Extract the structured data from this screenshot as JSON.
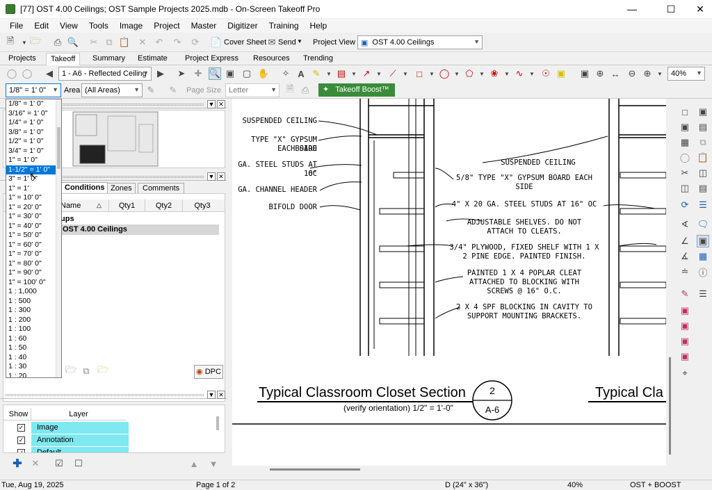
{
  "window": {
    "title": "[77] OST 4.00 Ceilings; OST Sample Projects 2025.mdb - On-Screen Takeoff Pro"
  },
  "menu": [
    "File",
    "Edit",
    "View",
    "Tools",
    "Image",
    "Project",
    "Master",
    "Digitizer",
    "Training",
    "Help"
  ],
  "toolbar1": {
    "cover_sheet": "Cover Sheet",
    "send": "Send",
    "project_view_label": "Project View",
    "project_view_value": "OST 4.00 Ceilings"
  },
  "tabs": [
    "Projects",
    "Takeoff",
    "Summary",
    "Estimate",
    "Project Express",
    "Resources",
    "Trending"
  ],
  "active_tab": "Takeoff",
  "toolbar2": {
    "page_select": "1 - A6 - Reflected Ceiling",
    "zoom": "40%"
  },
  "toolbar3": {
    "scale": "1/8\" = 1' 0\"",
    "area_label": "Area",
    "area_value": "(All Areas)",
    "page_size_label": "Page Size",
    "page_size_value": "Letter",
    "takeoff_boost": "Takeoff Boost™"
  },
  "scale_options": [
    "1/8\" = 1' 0\"",
    "3/16\" = 1' 0\"",
    "1/4\" = 1' 0\"",
    "3/8\" = 1' 0\"",
    "1/2\" = 1' 0\"",
    "3/4\" = 1' 0\"",
    "1\" = 1' 0\"",
    "1-1/2\" = 1' 0\"",
    "3\" = 1' 0\"",
    "1\" = 1'",
    "1\" = 10' 0\"",
    "1\" = 20' 0\"",
    "1\" = 30' 0\"",
    "1\" = 40' 0\"",
    "1\" = 50' 0\"",
    "1\" = 60' 0\"",
    "1\" = 70' 0\"",
    "1\" = 80' 0\"",
    "1\" = 90' 0\"",
    "1\" = 100' 0\"",
    "1 : 1,000",
    "1 : 500",
    "1 : 300",
    "1 : 200",
    "1 : 100",
    "1 : 60",
    "1 : 50",
    "1 : 40",
    "1 : 30",
    "1 : 20"
  ],
  "selected_scale": "1-1/2\" = 1' 0\"",
  "conditions": {
    "tabs": [
      "Conditions",
      "Zones",
      "Comments"
    ],
    "columns": [
      "Name",
      "Qty1",
      "Qty2",
      "Qty3"
    ],
    "group_label": "ups",
    "project_row": "OST 4.00 Ceilings",
    "dpc_button": "DPC"
  },
  "layers": {
    "columns": [
      "Show",
      "Layer"
    ],
    "rows": [
      {
        "name": "Image",
        "checked": true
      },
      {
        "name": "Annotation",
        "checked": true
      },
      {
        "name": "Default",
        "checked": true
      }
    ]
  },
  "drawing": {
    "left_labels": [
      "SUSPENDED CEILING",
      "TYPE \"X\" GYPSUM BOARD",
      "EACH SIDE",
      "GA. STEEL STUDS AT 16\"",
      "OC",
      "GA. CHANNEL HEADER",
      "BIFOLD DOOR"
    ],
    "right_labels": [
      "SUSPENDED CEILING",
      "5/8\" TYPE \"X\" GYPSUM BOARD EACH",
      "SIDE",
      "4\" X 20 GA. STEEL STUDS AT 16\" OC",
      "ADJUSTABLE SHELVES.  DO NOT",
      "ATTACH TO CLEATS.",
      "3/4\" PLYWOOD, FIXED SHELF WITH 1 X",
      "2 PINE EDGE.  PAINTED FINISH.",
      "PAINTED 1 X 4 POPLAR CLEAT",
      "ATTACHED TO BLOCKING WITH",
      "SCREWS @ 16\" O.C.",
      "2 X 4 SPF BLOCKING IN CAVITY TO",
      "SUPPORT MOUNTING BRACKETS."
    ],
    "section_title": "Typical Classroom Closet Section",
    "section_subtitle": "(verify orientation)  1/2\" = 1'-0\"",
    "section_number": "2",
    "section_sheet": "A-6",
    "section_title2": "Typical Cla"
  },
  "status": {
    "date": "Tue, Aug 19, 2025",
    "page": "Page 1 of 2",
    "size": "D (24\" x 36\")",
    "zoom": "40%",
    "mode": "OST + BOOST"
  }
}
